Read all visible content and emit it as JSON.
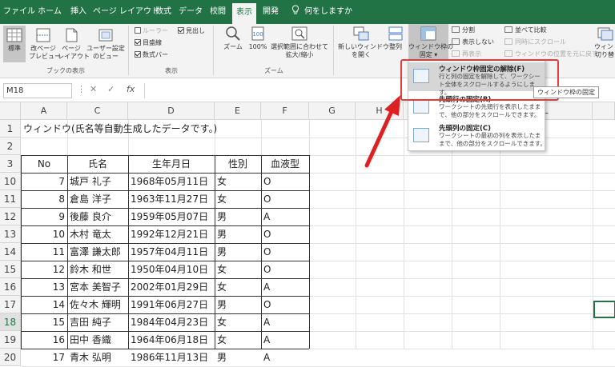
{
  "tabs": [
    {
      "label": "ファイル",
      "active": false
    },
    {
      "label": "ホーム",
      "active": false
    },
    {
      "label": "挿入",
      "active": false
    },
    {
      "label": "ページ レイアウト",
      "active": false
    },
    {
      "label": "数式",
      "active": false
    },
    {
      "label": "データ",
      "active": false
    },
    {
      "label": "校閲",
      "active": false
    },
    {
      "label": "表示",
      "active": true
    },
    {
      "label": "開発",
      "active": false
    },
    {
      "label": "何をしますか",
      "active": false
    }
  ],
  "ribbon": {
    "book_views": {
      "normal": "標準",
      "page_break_1": "改ページ",
      "page_break_2": "プレビュー",
      "page_layout_1": "ページ",
      "page_layout_2": "レイアウト",
      "custom_1": "ユーザー設定",
      "custom_2": "のビュー",
      "group_label": "ブックの表示"
    },
    "show": {
      "ruler": "ルーラー",
      "formula_bar_label": "見出し",
      "gridlines": "目盛線",
      "formula_bar": "数式バー",
      "group_label": "表示"
    },
    "zoom": {
      "zoom": "ズーム",
      "hundred": "100%",
      "fit_1": "選択範囲に合わせて",
      "fit_2": "拡大/縮小",
      "group_label": "ズーム"
    },
    "window": {
      "new_window_1": "新しいウィンドウ",
      "new_window_2": "を開く",
      "arrange": "整列",
      "freeze_1": "ウィンドウ枠の",
      "freeze_2": "固定 ▾",
      "split": "分割",
      "hide": "表示しない",
      "unhide": "再表示",
      "side_by_side": "並べて比較",
      "sync_scroll": "同時にスクロール",
      "reset_pos": "ウィンドウの位置を元に戻す",
      "switch_1": "ウィンドウ",
      "switch_2": "切り替"
    }
  },
  "formula_bar": {
    "name_box": "M18",
    "cancel": "✕",
    "enter": "✓",
    "fx": "fx"
  },
  "grid": {
    "columns": [
      "A",
      "C",
      "D",
      "E",
      "F",
      "G",
      "H",
      "",
      "",
      "L",
      ""
    ],
    "title_text": "ウィンドウ(氏名等自動生成したデータです。)",
    "headers": [
      "No",
      "氏名",
      "生年月日",
      "性別",
      "血液型"
    ],
    "row_numbers": [
      "1",
      "2",
      "3",
      "10",
      "11",
      "12",
      "13",
      "14",
      "15",
      "16",
      "17",
      "18",
      "19",
      "20"
    ],
    "rows": [
      [
        "7",
        "城戸 礼子",
        "1968年05月11日",
        "女",
        "O"
      ],
      [
        "8",
        "倉島 洋子",
        "1963年11月27日",
        "女",
        "O"
      ],
      [
        "9",
        "後藤 良介",
        "1959年05月07日",
        "男",
        "A"
      ],
      [
        "10",
        "木村 竜太",
        "1992年12月21日",
        "男",
        "O"
      ],
      [
        "11",
        "富澤 謙太郎",
        "1957年04月11日",
        "男",
        "O"
      ],
      [
        "12",
        "鈴木 和世",
        "1950年04月10日",
        "女",
        "O"
      ],
      [
        "13",
        "宮本 美智子",
        "2002年01月29日",
        "女",
        "A"
      ],
      [
        "14",
        "佐々木 輝明",
        "1991年06月27日",
        "男",
        "O"
      ],
      [
        "15",
        "吉田 純子",
        "1984年04月23日",
        "女",
        "A"
      ],
      [
        "16",
        "田中 香織",
        "1964年06月18日",
        "女",
        "A"
      ],
      [
        "17",
        "青木 弘明",
        "1986年11月13日",
        "男",
        "A"
      ]
    ]
  },
  "dropdown": {
    "items": [
      {
        "title": "ウィンドウ枠固定の解除(F)",
        "desc": "行と列の固定を解除して、ワークシート全体をスクロールするようにします。"
      },
      {
        "title": "先頭行の固定(R)",
        "desc": "ワークシートの先頭行を表示したままで、他の部分をスクロールできます。"
      },
      {
        "title": "先頭列の固定(C)",
        "desc": "ワークシートの最初の列を表示したままで、他の部分をスクロールできます。"
      }
    ],
    "tooltip": "ウィンドウ枠の固定"
  },
  "colors": {
    "excel_green": "#217346",
    "highlight_red": "#e03c3c",
    "arrow_red": "#e02020"
  }
}
